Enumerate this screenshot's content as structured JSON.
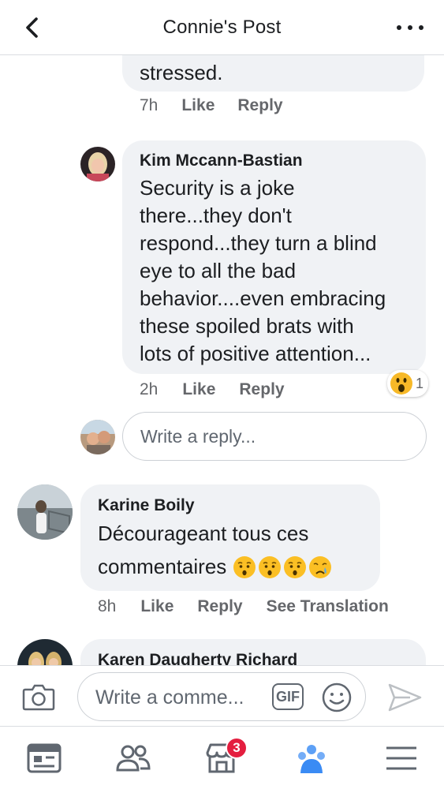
{
  "header": {
    "title": "Connie's Post",
    "back_icon": "chevron-left-icon",
    "more_icon": "more-dots-icon"
  },
  "comments": [
    {
      "partial_text": "stressed.",
      "time": "7h",
      "like": "Like",
      "reply": "Reply"
    },
    {
      "author": "Kim Mccann-Bastian",
      "lines": [
        "Security is a joke",
        "there...they don't",
        "respond...they turn a blind",
        "eye to all the bad",
        "behavior....even embracing",
        "these spoiled brats with",
        "lots of positive attention..."
      ],
      "time": "2h",
      "like": "Like",
      "reply": "Reply",
      "reaction": {
        "icon": "wow-emoji-icon",
        "count": "1"
      }
    },
    {
      "author": "Karine Boily",
      "lines": [
        "Décourageant tous ces",
        "commentaires"
      ],
      "emojis": [
        "hushed-face-emoji",
        "hushed-face-emoji",
        "hushed-face-emoji",
        "crying-face-emoji"
      ],
      "time": "8h",
      "like": "Like",
      "reply": "Reply",
      "translate": "See Translation"
    },
    {
      "author": "Karen Daugherty Richard"
    }
  ],
  "reply_box": {
    "placeholder": "Write a reply..."
  },
  "composer": {
    "placeholder": "Write a comme...",
    "gif_label": "GIF"
  },
  "tabbar": {
    "items": [
      "news-feed-icon",
      "friends-icon",
      "marketplace-icon",
      "groups-icon",
      "menu-icon"
    ],
    "marketplace_badge": "3"
  },
  "colors": {
    "bubble": "#f0f2f5",
    "meta_text": "#65676b",
    "badge": "#e41e3f",
    "send_icon": "#bcc0c4",
    "groups_blue": "#1877f2"
  }
}
